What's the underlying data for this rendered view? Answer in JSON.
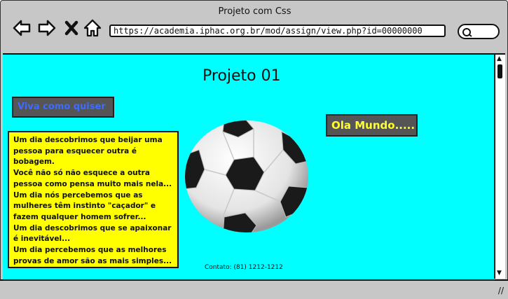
{
  "browser": {
    "title": "Projeto com Css",
    "url": "https://academia.iphac.org.br/mod/assign/view.php?id=00000000"
  },
  "page": {
    "heading": "Projeto 01",
    "button_viva": "Viva como quiser",
    "button_ola": "Ola Mundo.....",
    "paragraph_lines": [
      "Um dia descobrimos que beijar uma pessoa para esquecer outra é bobagem.",
      "Você não só não esquece a outra pessoa como pensa muito mais nela...",
      "Um dia nós percebemos que as mulheres têm instinto \"caçador\" e fazem qualquer homem sofrer...",
      "Um dia descobrimos que se apaixonar é inevitável...",
      "Um dia percebemos que as melhores provas de amor são as mais simples..."
    ],
    "contact": "Contato: (81) 1212-1212"
  },
  "colors": {
    "background": "#00ffff",
    "textbox": "#ffff00",
    "button": "#555555",
    "button_viva_text": "#3c6cff",
    "button_ola_text": "#ffff33"
  },
  "icons": [
    "back-arrow-icon",
    "forward-arrow-icon",
    "close-x-icon",
    "home-icon",
    "search-icon",
    "resize-grip-icon"
  ]
}
